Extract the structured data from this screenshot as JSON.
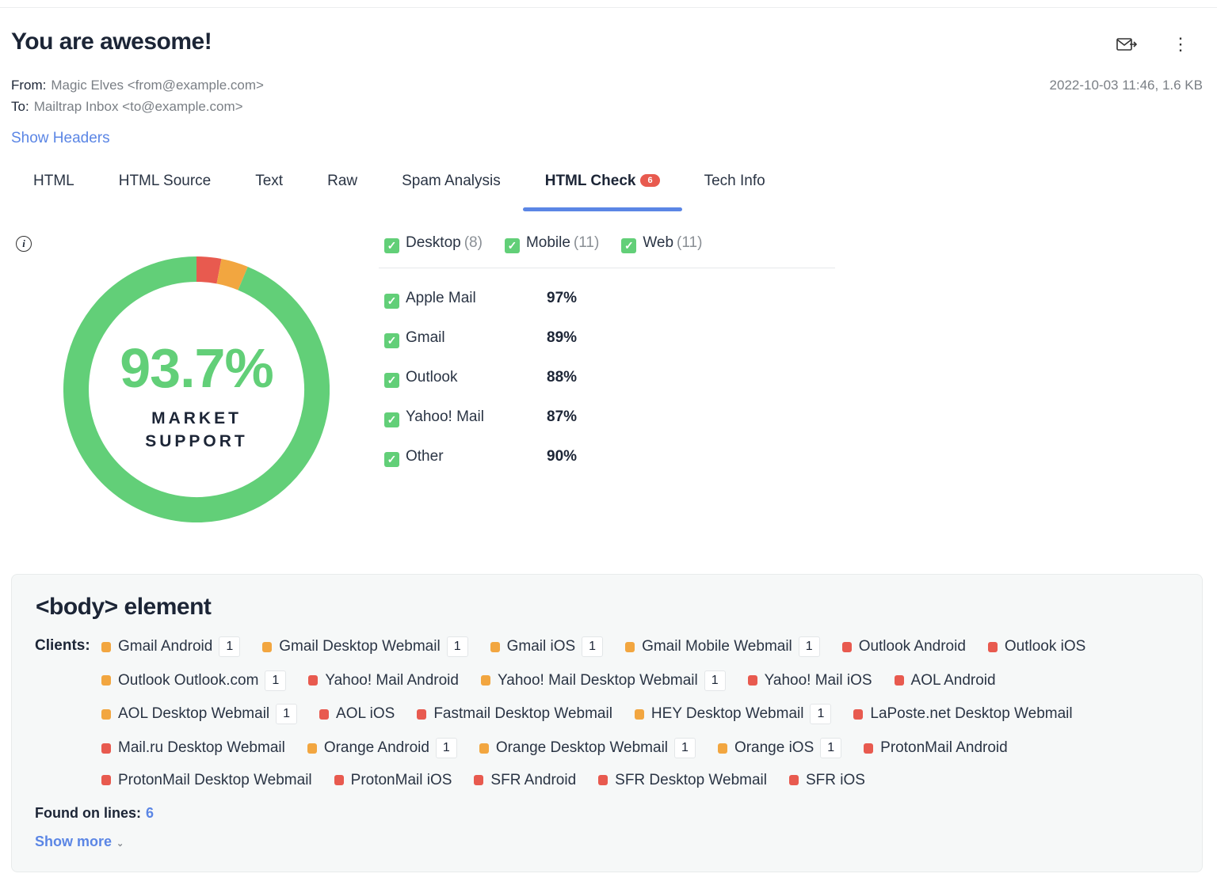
{
  "email": {
    "subject": "You are awesome!",
    "from_label": "From:",
    "from": "Magic Elves <from@example.com>",
    "to_label": "To:",
    "to": "Mailtrap Inbox <to@example.com>",
    "date_size": "2022-10-03 11:46, 1.6 KB",
    "show_headers": "Show Headers"
  },
  "toolbar": {
    "icons": [
      "forward-mail-icon",
      "more-vertical-icon"
    ]
  },
  "tabs": [
    {
      "label": "HTML"
    },
    {
      "label": "HTML Source"
    },
    {
      "label": "Text"
    },
    {
      "label": "Raw"
    },
    {
      "label": "Spam Analysis"
    },
    {
      "label": "HTML Check",
      "badge": "6",
      "active": true
    },
    {
      "label": "Tech Info"
    }
  ],
  "score": {
    "value": "93.7%",
    "label_line1": "MARKET",
    "label_line2": "SUPPORT",
    "supported_pct": 93.7,
    "unsupported_pct": 3.0,
    "partial_pct": 3.3,
    "colors": {
      "supported": "#62cf78",
      "unsupported": "#e85a4f",
      "partial": "#f2a640"
    }
  },
  "filters": [
    {
      "label": "Desktop",
      "count": "(8)",
      "checked": true
    },
    {
      "label": "Mobile",
      "count": "(11)",
      "checked": true
    },
    {
      "label": "Web",
      "count": "(11)",
      "checked": true
    }
  ],
  "clients": [
    {
      "label": "Apple Mail",
      "value": "97%"
    },
    {
      "label": "Gmail",
      "value": "89%"
    },
    {
      "label": "Outlook",
      "value": "88%"
    },
    {
      "label": "Yahoo! Mail",
      "value": "87%"
    },
    {
      "label": "Other",
      "value": "90%"
    }
  ],
  "issue": {
    "title": "<body> element",
    "clients_label": "Clients:",
    "found_label": "Found on lines:",
    "found_value": "6",
    "show_more": "Show more",
    "rows": [
      [
        {
          "name": "Gmail Android",
          "status": "partial",
          "count": "1"
        },
        {
          "name": "Gmail Desktop Webmail",
          "status": "partial",
          "count": "1"
        },
        {
          "name": "Gmail iOS",
          "status": "partial",
          "count": "1"
        },
        {
          "name": "Gmail Mobile Webmail",
          "status": "partial",
          "count": "1"
        },
        {
          "name": "Outlook Android",
          "status": "unsupported"
        },
        {
          "name": "Outlook iOS",
          "status": "unsupported"
        }
      ],
      [
        {
          "name": "Outlook Outlook.com",
          "status": "partial",
          "count": "1"
        },
        {
          "name": "Yahoo! Mail Android",
          "status": "unsupported"
        },
        {
          "name": "Yahoo! Mail Desktop Webmail",
          "status": "partial",
          "count": "1"
        },
        {
          "name": "Yahoo! Mail iOS",
          "status": "unsupported"
        },
        {
          "name": "AOL Android",
          "status": "unsupported"
        }
      ],
      [
        {
          "name": "AOL Desktop Webmail",
          "status": "partial",
          "count": "1"
        },
        {
          "name": "AOL iOS",
          "status": "unsupported"
        },
        {
          "name": "Fastmail Desktop Webmail",
          "status": "unsupported"
        },
        {
          "name": "HEY Desktop Webmail",
          "status": "partial",
          "count": "1"
        },
        {
          "name": "LaPoste.net Desktop Webmail",
          "status": "unsupported"
        }
      ],
      [
        {
          "name": "Mail.ru Desktop Webmail",
          "status": "unsupported"
        },
        {
          "name": "Orange Android",
          "status": "partial",
          "count": "1"
        },
        {
          "name": "Orange Desktop Webmail",
          "status": "partial",
          "count": "1"
        },
        {
          "name": "Orange iOS",
          "status": "partial",
          "count": "1"
        },
        {
          "name": "ProtonMail Android",
          "status": "unsupported"
        }
      ],
      [
        {
          "name": "ProtonMail Desktop Webmail",
          "status": "unsupported"
        },
        {
          "name": "ProtonMail iOS",
          "status": "unsupported"
        },
        {
          "name": "SFR Android",
          "status": "unsupported"
        },
        {
          "name": "SFR Desktop Webmail",
          "status": "unsupported"
        },
        {
          "name": "SFR iOS",
          "status": "unsupported"
        }
      ]
    ]
  }
}
